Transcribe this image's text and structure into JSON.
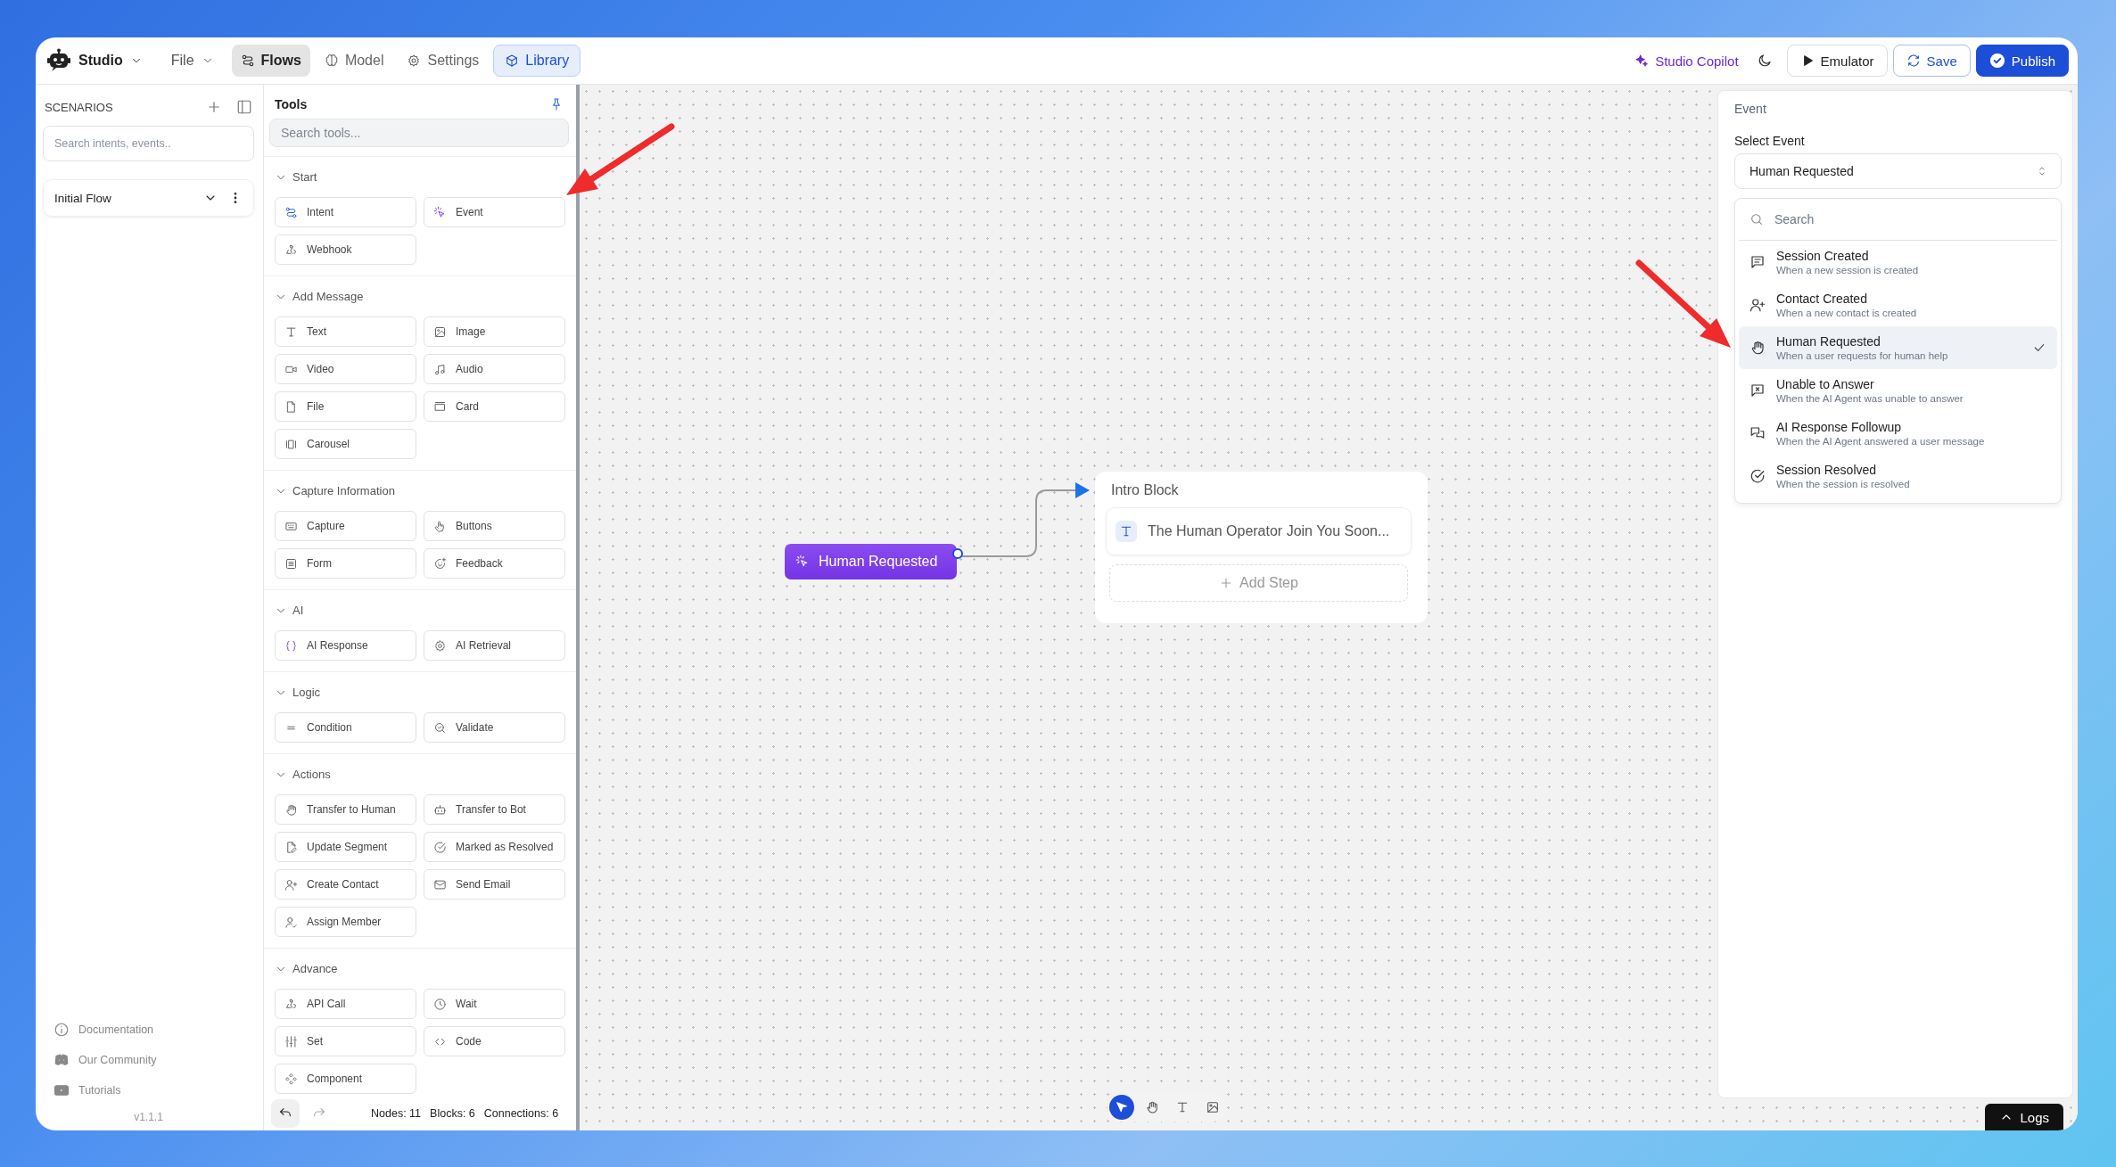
{
  "app_bar": {
    "brand": "Studio",
    "menus": [
      {
        "label": "File"
      }
    ],
    "nav": [
      {
        "label": "Flows",
        "selected": true
      },
      {
        "label": "Model",
        "selected": false
      },
      {
        "label": "Settings",
        "selected": false
      }
    ],
    "library": {
      "label": "Library",
      "on": true
    },
    "copilot": "Studio Copilot",
    "emulator": "Emulator",
    "save": "Save",
    "publish": "Publish"
  },
  "scenarios": {
    "title": "SCENARIOS",
    "search_placeholder": "Search intents, events..",
    "flows": [
      {
        "label": "Initial Flow"
      }
    ],
    "footer_links": [
      "Documentation",
      "Our Community",
      "Tutorials"
    ],
    "version": "v1.1.1"
  },
  "tools": {
    "title": "Tools",
    "search_placeholder": "Search tools...",
    "sections": [
      {
        "title": "Start",
        "expanded": true,
        "items": [
          "Intent",
          "Event",
          "Webhook"
        ]
      },
      {
        "title": "Add Message",
        "expanded": true,
        "items": [
          "Text",
          "Image",
          "Video",
          "Audio",
          "File",
          "Card",
          "Carousel"
        ]
      },
      {
        "title": "Capture Information",
        "expanded": true,
        "items": [
          "Capture",
          "Buttons",
          "Form",
          "Feedback"
        ]
      },
      {
        "title": "AI",
        "expanded": true,
        "items": [
          "AI Response",
          "AI Retrieval"
        ]
      },
      {
        "title": "Logic",
        "expanded": true,
        "items": [
          "Condition",
          "Validate"
        ]
      },
      {
        "title": "Actions",
        "expanded": true,
        "items": [
          "Transfer to Human",
          "Transfer to Bot",
          "Update Segment",
          "Marked as Resolved",
          "Create Contact",
          "Send Email",
          "Assign Member"
        ]
      },
      {
        "title": "Advance",
        "expanded": true,
        "items": [
          "API Call",
          "Wait",
          "Set",
          "Code",
          "Component"
        ]
      }
    ],
    "undo": {
      "disabled": false
    },
    "redo": {
      "disabled": true
    },
    "stats": [
      "Nodes: 11",
      "Blocks: 6",
      "Connections: 6"
    ]
  },
  "canvas": {
    "trigger": {
      "label": "Human Requested"
    },
    "blocks": [
      {
        "title": "Intro Block",
        "steps": [
          {
            "text": "The Human Operator Join You Soon..."
          }
        ],
        "add_step": "Add Step"
      }
    ],
    "tools": [
      {
        "selected": true
      },
      {
        "selected": false
      },
      {
        "selected": false
      },
      {
        "selected": false
      }
    ],
    "logs": "Logs"
  },
  "event_panel": {
    "title": "Event",
    "field_label": "Select Event",
    "value": "Human Requested",
    "search_placeholder": "Search",
    "options": [
      {
        "title": "Session Created",
        "description": "When a new session is created",
        "selected": false
      },
      {
        "title": "Contact Created",
        "description": "When a new contact is created",
        "selected": false
      },
      {
        "title": "Human Requested",
        "description": "When a user requests for human help",
        "selected": true
      },
      {
        "title": "Unable to Answer",
        "description": "When the AI Agent was unable to answer",
        "selected": false
      },
      {
        "title": "AI Response Followup",
        "description": "When the AI Agent answered a user message",
        "selected": false
      },
      {
        "title": "Session Resolved",
        "description": "When the session is resolved",
        "selected": false
      }
    ]
  }
}
